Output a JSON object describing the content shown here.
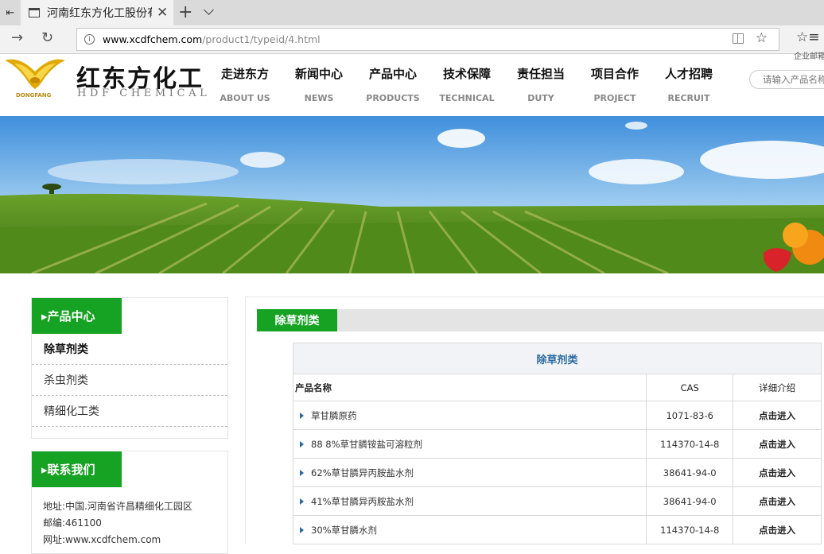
{
  "browser": {
    "tab_title": "河南红东方化工股份有限公司",
    "url_domain": "www.xcdfchem.com",
    "url_path": "/product1/typeid/4.html",
    "icons": [
      "tab-actions-icon",
      "page-icon",
      "close-icon",
      "new-tab-icon",
      "tab-list-icon",
      "back-icon",
      "refresh-icon",
      "info-icon",
      "reading-view-icon",
      "favorite-star-icon",
      "favorites-hub-icon"
    ]
  },
  "site": {
    "logo_text": "DONGFANG",
    "brand_cn": "红东方化工",
    "brand_en": "HDF CHEMICAL",
    "top_note": "企业邮箱",
    "search_placeholder": "请输入产品名称",
    "menu": [
      {
        "cn": "走进东方",
        "en": "ABOUT US"
      },
      {
        "cn": "新闻中心",
        "en": "NEWS"
      },
      {
        "cn": "产品中心",
        "en": "PRODUCTS"
      },
      {
        "cn": "技术保障",
        "en": "TECHNICAL"
      },
      {
        "cn": "责任担当",
        "en": "DUTY"
      },
      {
        "cn": "项目合作",
        "en": "PROJECT"
      },
      {
        "cn": "人才招聘",
        "en": "RECRUIT"
      }
    ]
  },
  "sidebar": {
    "products_title": "产品中心",
    "categories": [
      "除草剂类",
      "杀虫剂类",
      "精细化工类"
    ],
    "contact_title": "联系我们",
    "contact_lines": [
      "地址:中国.河南省许昌精细化工园区",
      "邮编:461100",
      "网址:www.xcdfchem.com"
    ]
  },
  "main": {
    "category_tab": "除草剂类",
    "table_caption": "除草剂类",
    "columns": [
      "产品名称",
      "CAS",
      "详细介绍"
    ],
    "rows": [
      {
        "name": "草甘膦原药",
        "cas": "1071-83-6",
        "link": "点击进入"
      },
      {
        "name": "88 8%草甘膦铵盐可溶粒剂",
        "cas": "114370-14-8",
        "link": "点击进入"
      },
      {
        "name": "62%草甘膦异丙胺盐水剂",
        "cas": "38641-94-0",
        "link": "点击进入"
      },
      {
        "name": "41%草甘膦异丙胺盐水剂",
        "cas": "38641-94-0",
        "link": "点击进入"
      },
      {
        "name": "30%草甘膦水剂",
        "cas": "114370-14-8",
        "link": "点击进入"
      }
    ]
  },
  "colors": {
    "accent_green": "#16a222",
    "caption_blue": "#2a6aa0"
  }
}
